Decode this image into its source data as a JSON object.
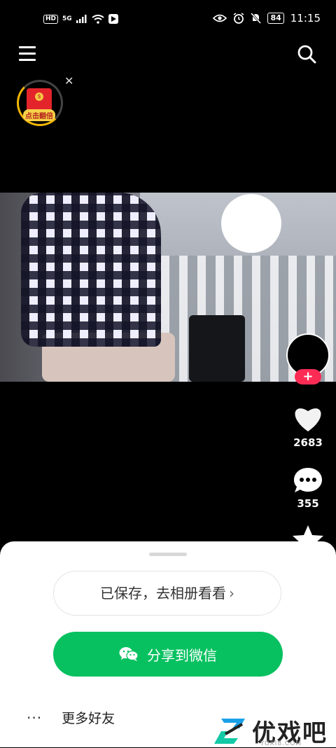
{
  "status_bar": {
    "hd": "HD",
    "network": "5G",
    "battery": "84",
    "time": "11:15"
  },
  "red_packet": {
    "coin": "$",
    "label": "点击翻倍"
  },
  "actions": {
    "like_count": "2683",
    "comment_count": "355"
  },
  "sheet": {
    "saved_label": "已保存，去相册看看",
    "chevron": "›",
    "share_wechat_label": "分享到微信",
    "more_dots": "···",
    "more_friends_label": "更多好友"
  },
  "watermark": {
    "text": "优戏吧",
    "sub": "YOXI8.COM"
  },
  "colors": {
    "wechat_green": "#07c160",
    "follow_red": "#fe2c55",
    "red_packet": "#e3242b"
  }
}
